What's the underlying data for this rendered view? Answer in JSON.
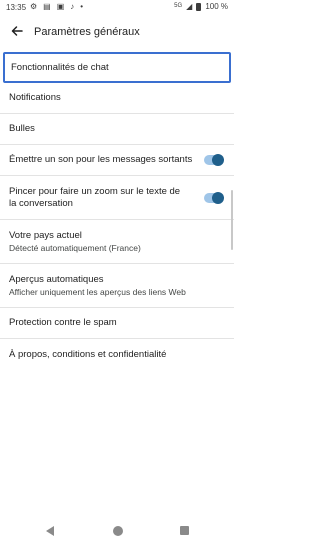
{
  "status_bar": {
    "time": "13:35",
    "network": "5G",
    "battery": "100 %"
  },
  "header": {
    "title": "Paramètres généraux"
  },
  "settings": [
    {
      "label": "Fonctionnalités de chat",
      "selected": true
    },
    {
      "label": "Notifications"
    },
    {
      "label": "Bulles"
    },
    {
      "label": "Émettre un son pour les messages sortants",
      "toggle": true,
      "enabled": true
    },
    {
      "label": "Pincer pour faire un zoom sur le texte de la conversation",
      "toggle": true,
      "enabled": true
    },
    {
      "label": "Votre pays actuel",
      "subtitle": "Détecté automatiquement (France)"
    },
    {
      "label": "Aperçus automatiques",
      "subtitle": "Afficher uniquement les aperçus des liens Web"
    },
    {
      "label": "Protection contre le spam"
    },
    {
      "label": "À propos, conditions et confidentialité"
    }
  ],
  "colors": {
    "accent_border": "#3a6fd0",
    "toggle_knob": "#1f5f8b",
    "toggle_track": "#9fc5e8"
  },
  "icons": [
    "gear-icon",
    "sim-icon",
    "image-icon",
    "music-note-icon",
    "dot-icon",
    "signal-icon",
    "battery-icon",
    "back-arrow-icon"
  ]
}
